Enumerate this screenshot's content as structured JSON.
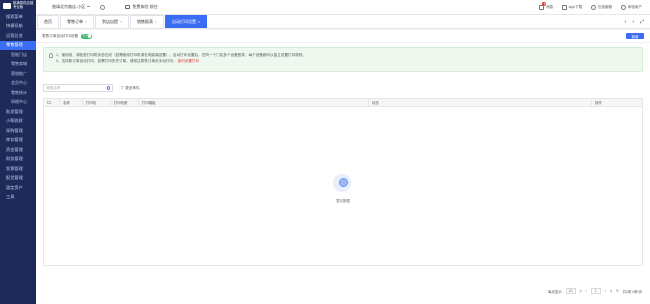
{
  "app": {
    "logo_text": "桃满易供应链\n专业版"
  },
  "sidebar": {
    "items": [
      {
        "label": "搜索菜单",
        "type": "normal"
      },
      {
        "label": "快捷导航",
        "type": "normal"
      },
      {
        "label": "运营总览",
        "type": "normal"
      },
      {
        "label": "零售管理",
        "type": "active"
      },
      {
        "label": "智能门店",
        "type": "sub"
      },
      {
        "label": "零售商城",
        "type": "sub"
      },
      {
        "label": "营销推广",
        "type": "sub"
      },
      {
        "label": "会员中心",
        "type": "sub"
      },
      {
        "label": "零售统计",
        "type": "sub"
      },
      {
        "label": "网格中心",
        "type": "sub"
      },
      {
        "label": "批发管理",
        "type": "normal"
      },
      {
        "label": "小帮收款",
        "type": "normal"
      },
      {
        "label": "采购管理",
        "type": "normal"
      },
      {
        "label": "库存管理",
        "type": "normal"
      },
      {
        "label": "资金管理",
        "type": "normal"
      },
      {
        "label": "财务管理",
        "type": "normal"
      },
      {
        "label": "发票管理",
        "type": "normal"
      },
      {
        "label": "配货管理",
        "type": "normal"
      },
      {
        "label": "固定资产",
        "type": "normal"
      },
      {
        "label": "工具",
        "type": "normal"
      }
    ]
  },
  "topbar": {
    "store": "曲靖北京路店-小区",
    "link": "免费体验·前往",
    "messages_label": "消息",
    "messages_badge": "8",
    "app_label": "App下载",
    "service_label": "在线客服",
    "user_label": "体验用户"
  },
  "tabs": [
    {
      "label": "首页",
      "active": false,
      "closable": false
    },
    {
      "label": "零售订单",
      "active": false,
      "closable": true
    },
    {
      "label": "到店自提",
      "active": false,
      "closable": true
    },
    {
      "label": "销售报表",
      "active": false,
      "closable": true
    },
    {
      "label": "自动打印设置",
      "active": true,
      "closable": true
    }
  ],
  "filterbar": {
    "toggle_label": "零售订单自动打印设置",
    "toggle_state": "已开启",
    "add_button": "新增"
  },
  "notice": {
    "line1": "1、使用前，请检查打印机状态在线（如需使用打印机请在电脑端设置）。自动打印设置后，在同一个门店多个设备登录，每个设备都可以独立设置打印规则。",
    "line2": "2、支持新订单自动打印，如需打印历史订单，请前往零售订单页手动打印。",
    "link": "如何设置打印"
  },
  "search": {
    "placeholder": "搜索名称",
    "more": "更多条件"
  },
  "table": {
    "columns": [
      "名称",
      "打印机",
      "打印份数",
      "打印模板",
      "状态",
      "操作"
    ]
  },
  "empty_text": "暂无数据",
  "pager": {
    "page_size_label": "每页显示",
    "page_size": "10",
    "page": "1",
    "total": "共0条 0条/页"
  }
}
